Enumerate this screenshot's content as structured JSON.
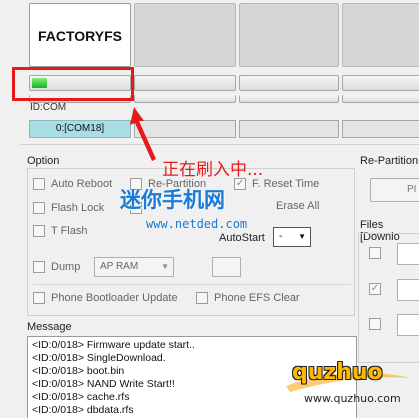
{
  "slots": {
    "main_title": "FACTORYFS"
  },
  "progress": {
    "slot1_fill_percent": 15
  },
  "idcom": {
    "label": "ID:COM",
    "port": "0:[COM18]"
  },
  "annotation": {
    "text": "正在刷入中..."
  },
  "option": {
    "heading": "Option",
    "auto_reboot": "Auto Reboot",
    "re_partition": "Re-Partition",
    "f_reset_time": "F. Reset Time",
    "flash_lock": "Flash Lock",
    "erase_all": "Erase All",
    "t_flash": "T Flash",
    "auto_start_label": "AutoStart",
    "auto_start_value": "-",
    "dump": "Dump",
    "dump_select": "AP RAM",
    "phone_bootloader_update": "Phone Bootloader Update",
    "phone_efs_clear": "Phone EFS Clear"
  },
  "right_panel": {
    "repartition_heading": "Re-Partition",
    "pit_button": "PI",
    "files_heading": "Files [Downlo"
  },
  "message": {
    "heading": "Message",
    "lines": [
      "<ID:0/018> Firmware update start..",
      "<ID:0/018> SingleDownload.",
      "<ID:0/018> boot.bin",
      "<ID:0/018> NAND Write Start!!",
      "<ID:0/018> cache.rfs",
      "<ID:0/018> dbdata.rfs"
    ]
  },
  "watermarks": {
    "site_cn": "迷你手机网",
    "site_url": "www.netded.com",
    "logo_text": "quzhuo",
    "logo_url": "www.quzhuo.com"
  }
}
